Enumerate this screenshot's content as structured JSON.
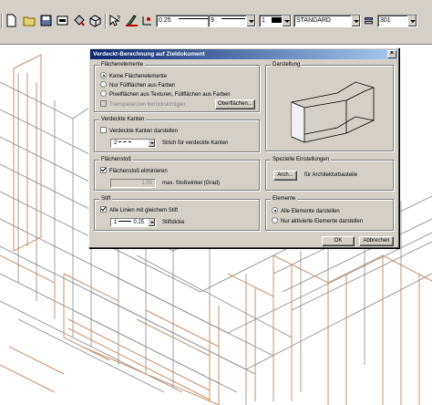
{
  "toolbar": {
    "pen_thickness": "0.25",
    "line_type": "9",
    "color_index": "1",
    "layer": "STANDARD",
    "combo_value": "301"
  },
  "dialog": {
    "title": "Verdeckt-Berechnung auf Zieldokument",
    "close_glyph": "×",
    "flaechenelemente": {
      "legend": "Flächenelemente",
      "options": [
        "Keine Flächenelemente",
        "Nur Füllflächen aus Farben",
        "Pixelflächen aus Texturen, Füllflächen aus Farben"
      ],
      "selected_index": 0,
      "transparency_label": "Transparenzen berücksichtigen",
      "surfaces_button": "Oberflächen..."
    },
    "darstellung": {
      "legend": "Darstellung"
    },
    "verdeckte_kanten": {
      "legend": "Verdeckte Kanten",
      "show_label": "Verdeckte Kanten darstellen",
      "line_value": "2",
      "line_suffix": "Strich für verdeckte Kanten"
    },
    "flaechenstoss": {
      "legend": "Flächenstoß",
      "eliminate_label": "Flächenstoß eliminieren",
      "angle_value": "1.00",
      "angle_label": "max. Stoßwinkel (Grad)"
    },
    "spezielle": {
      "legend": "Spezielle Einstellungen",
      "arch_button": "Arch...",
      "arch_label": "für Architekturbauteile"
    },
    "stift": {
      "legend": "Stift",
      "same_label": "Alle Linien mit gleichem Stift",
      "pen_value": "1",
      "thickness_value": "0.25",
      "thickness_label": "Stiftdicke"
    },
    "elemente": {
      "legend": "Elemente",
      "options": [
        "Alle Elemente darstellen",
        "Nur aktivierte Elemente darstellen"
      ],
      "selected_index": 0
    },
    "ok_button": "OK",
    "cancel_button": "Abbrechen"
  },
  "colors": {
    "dialog_face": "#d4d0c8",
    "title_start": "#0a246a",
    "title_end": "#a6caf0",
    "wire_brown": "#c8906a",
    "wire_grey": "#8a8a8a"
  }
}
